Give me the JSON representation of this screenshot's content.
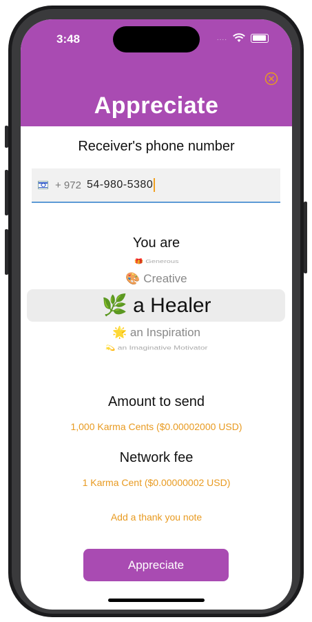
{
  "status_bar": {
    "time": "3:48",
    "signal": "....",
    "icons": [
      "wifi-icon",
      "battery-icon"
    ]
  },
  "header": {
    "title": "Appreciate",
    "close_icon": "close-circle-icon",
    "background": "#a94bb2",
    "accent": "#e89a20"
  },
  "receiver": {
    "label": "Receiver's  phone number",
    "country_flag": "israel-flag-icon",
    "dial_code": "+ 972",
    "phone_value": "54-980-5380"
  },
  "traits": {
    "label": "You are",
    "options": [
      {
        "emoji": "🎁",
        "text": "Generous"
      },
      {
        "emoji": "🎨",
        "text": "Creative"
      },
      {
        "emoji": "🌿",
        "text": "a Healer"
      },
      {
        "emoji": "🌟",
        "text": "an Inspiration"
      },
      {
        "emoji": "💫",
        "text": "an Imaginative Motivator"
      }
    ],
    "selected_index": 2
  },
  "amount": {
    "label": "Amount to send",
    "value": "1,000 Karma Cents ($0.00002000 USD)"
  },
  "fee": {
    "label": "Network fee",
    "value": "1 Karma Cent ($0.00000002 USD)"
  },
  "note_link": "Add a thank you note",
  "submit_label": "Appreciate"
}
